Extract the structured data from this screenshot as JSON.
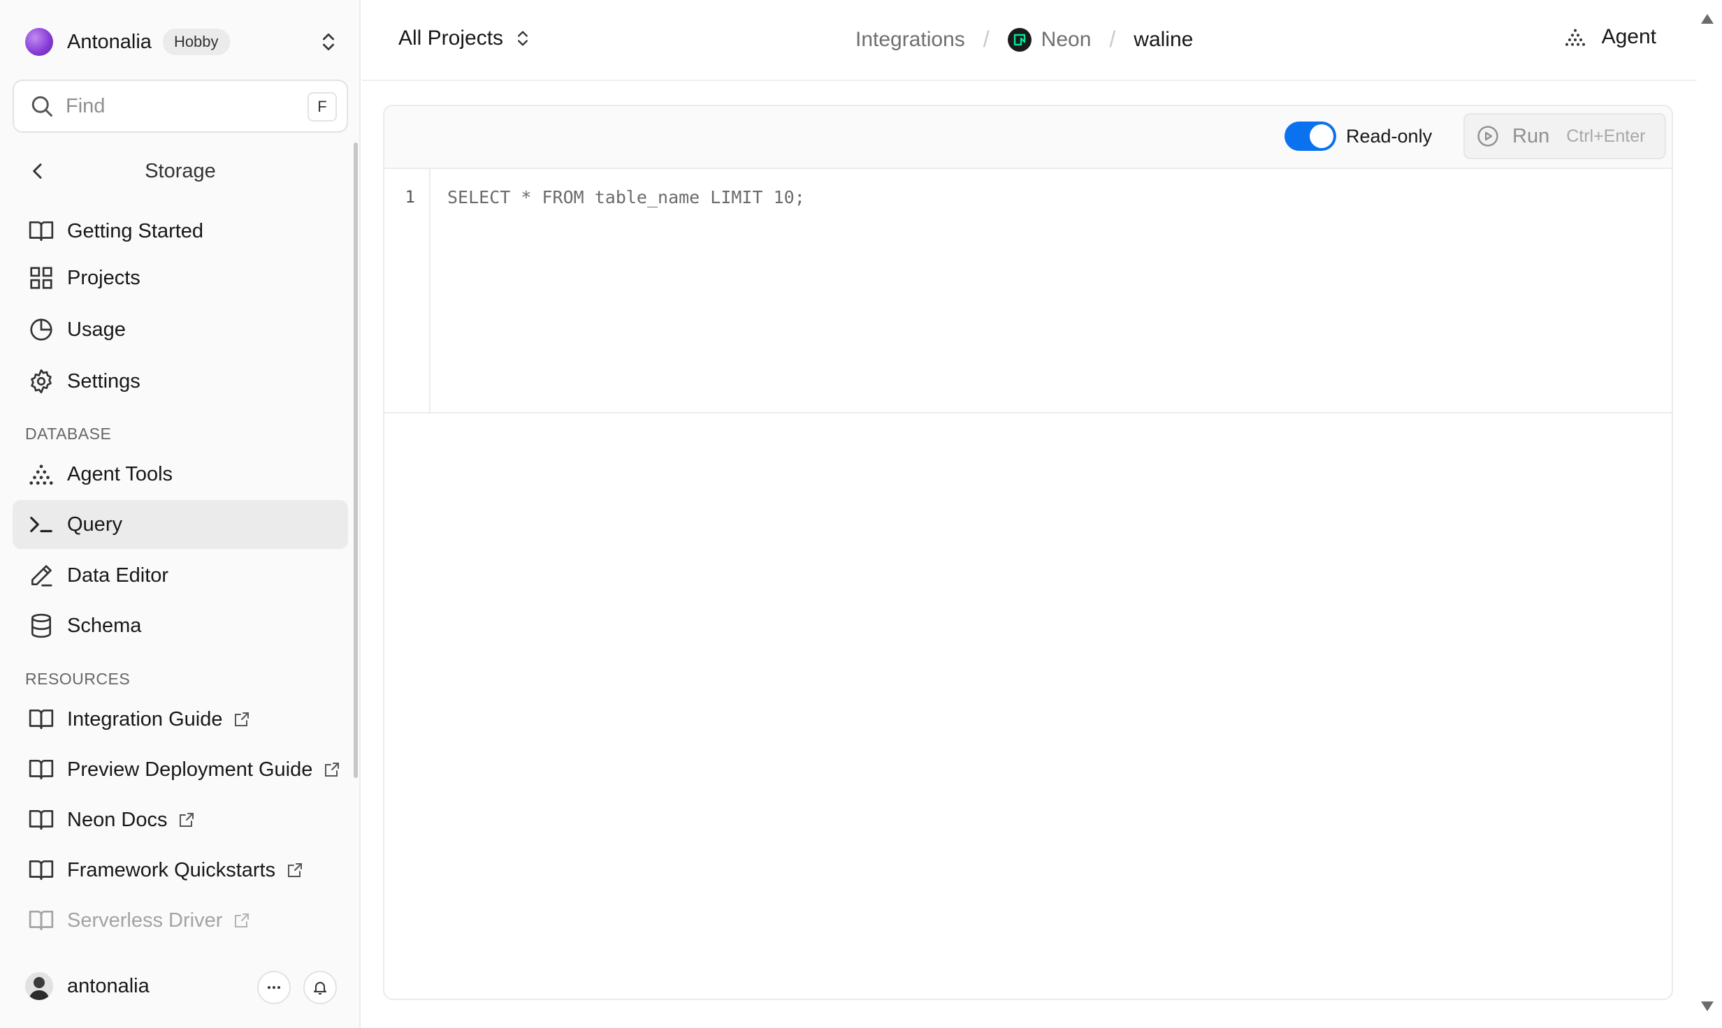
{
  "team": {
    "name": "Antonalia",
    "plan": "Hobby"
  },
  "search": {
    "placeholder": "Find",
    "shortcut": "F"
  },
  "sidebar": {
    "section_title": "Storage",
    "top_items": [
      {
        "label": "Getting Started",
        "icon": "book-icon"
      },
      {
        "label": "Projects",
        "icon": "grid-icon"
      },
      {
        "label": "Usage",
        "icon": "pie-chart-icon"
      },
      {
        "label": "Settings",
        "icon": "gear-icon"
      }
    ],
    "database_label": "DATABASE",
    "database_items": [
      {
        "label": "Agent Tools",
        "icon": "agent-icon"
      },
      {
        "label": "Query",
        "icon": "terminal-icon",
        "active": true
      },
      {
        "label": "Data Editor",
        "icon": "pencil-icon"
      },
      {
        "label": "Schema",
        "icon": "database-icon"
      }
    ],
    "resources_label": "RESOURCES",
    "resource_items": [
      {
        "label": "Integration Guide",
        "icon": "book-icon",
        "external": true
      },
      {
        "label": "Preview Deployment Guide",
        "icon": "book-icon",
        "external": true
      },
      {
        "label": "Neon Docs",
        "icon": "book-icon",
        "external": true
      },
      {
        "label": "Framework Quickstarts",
        "icon": "book-icon",
        "external": true
      },
      {
        "label": "Serverless Driver",
        "icon": "book-icon",
        "external": true
      }
    ]
  },
  "user": {
    "name": "antonalia"
  },
  "topbar": {
    "project_selector": "All Projects",
    "breadcrumb": [
      "Integrations",
      "Neon",
      "waline"
    ],
    "agent_label": "Agent"
  },
  "editor": {
    "readonly_label": "Read-only",
    "readonly_on": true,
    "run_label": "Run",
    "run_shortcut": "Ctrl+Enter",
    "line_number": "1",
    "code": "SELECT * FROM table_name LIMIT 10;"
  },
  "colors": {
    "accent": "#0a72ef",
    "active_item_bg": "#ebebeb",
    "neon_green": "#00e599"
  }
}
